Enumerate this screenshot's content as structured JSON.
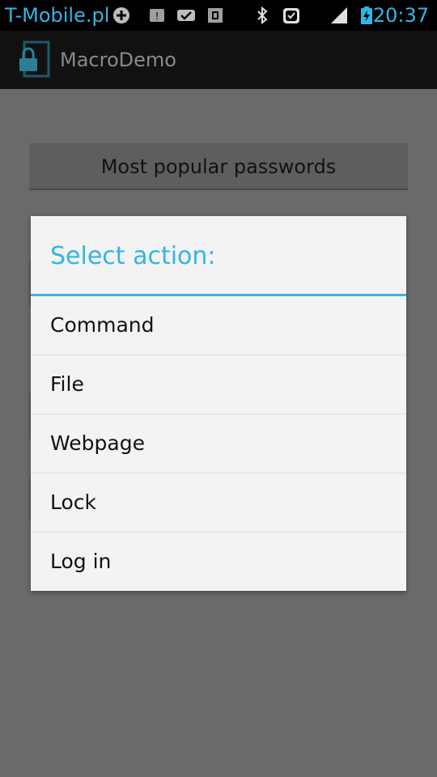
{
  "status_bar": {
    "carrier": "T-Mobile.pl",
    "time": "20:37",
    "icons": [
      "add-circle-icon",
      "notification-icon",
      "mail-check-icon",
      "package-icon",
      "bluetooth-icon",
      "alarm-clock-icon",
      "signal-icon",
      "battery-charging-icon"
    ],
    "accent_color": "#33b5e5"
  },
  "action_bar": {
    "title": "MacroDemo",
    "logo_icon": "lock-icon"
  },
  "content": {
    "main_button_label": "Most popular passwords"
  },
  "dialog": {
    "title": "Select action:",
    "items": [
      {
        "label": "Command"
      },
      {
        "label": "File"
      },
      {
        "label": "Webpage"
      },
      {
        "label": "Lock"
      },
      {
        "label": "Log in"
      }
    ]
  }
}
